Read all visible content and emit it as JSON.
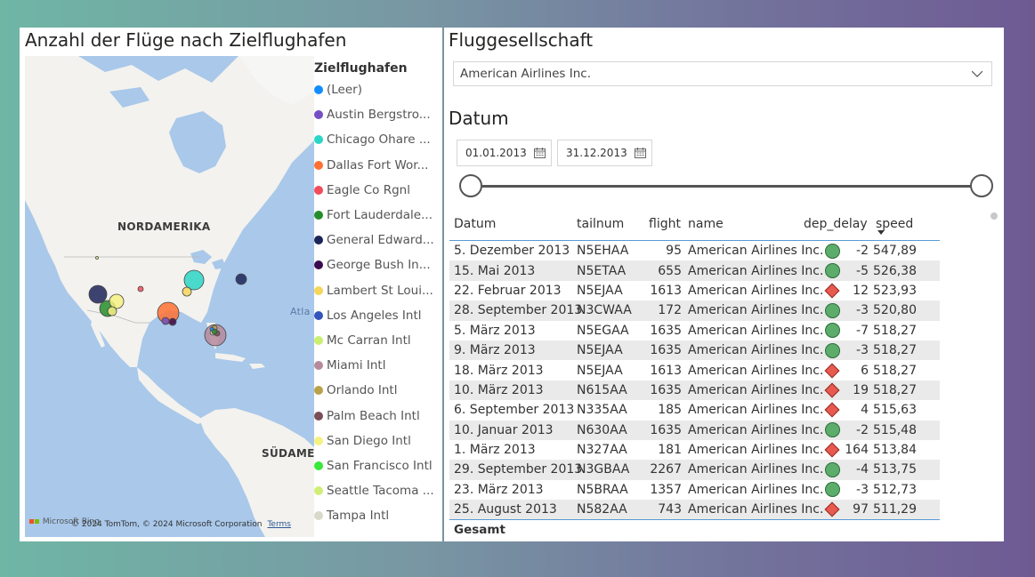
{
  "map_visual": {
    "title": "Anzahl der Flüge nach Zielflughafen",
    "continent_labels": [
      "NORDAMERIKA",
      "SÜDAMER",
      "Atla"
    ],
    "attribution": "© 2024 TomTom, © 2024 Microsoft Corporation",
    "terms_link": "Terms",
    "ms_logo_text": "Microsoft Bing"
  },
  "legend": {
    "title": "Zielflughafen",
    "items": [
      {
        "label": "(Leer)",
        "color": "#118dff"
      },
      {
        "label": "Austin Bergstro...",
        "color": "#744ec2"
      },
      {
        "label": "Chicago Ohare ...",
        "color": "#2ad6c6"
      },
      {
        "label": "Dallas Fort Wor...",
        "color": "#ff7133"
      },
      {
        "label": "Eagle Co Rgnl",
        "color": "#f04d58"
      },
      {
        "label": "Fort Lauderdale...",
        "color": "#268d2c"
      },
      {
        "label": "General Edward...",
        "color": "#1c2559"
      },
      {
        "label": "George Bush In...",
        "color": "#3a0c4f"
      },
      {
        "label": "Lambert St Loui...",
        "color": "#f5d55a"
      },
      {
        "label": "Los Angeles Intl",
        "color": "#3454bd"
      },
      {
        "label": "Mc Carran Intl",
        "color": "#c9ef70"
      },
      {
        "label": "Miami Intl",
        "color": "#b68a9c"
      },
      {
        "label": "Orlando Intl",
        "color": "#b9a24a"
      },
      {
        "label": "Palm Beach Intl",
        "color": "#7b4e55"
      },
      {
        "label": "San Diego Intl",
        "color": "#f6f282"
      },
      {
        "label": "San Francisco Intl",
        "color": "#39e839"
      },
      {
        "label": "Seattle Tacoma ...",
        "color": "#cfee77"
      },
      {
        "label": "Tampa Intl",
        "color": "#d9d9c9"
      }
    ]
  },
  "airline_slicer": {
    "title": "Fluggesellschaft",
    "selected": "American Airlines Inc."
  },
  "date_slicer": {
    "title": "Datum",
    "from": "01.01.2013",
    "to": "31.12.2013"
  },
  "table": {
    "columns": [
      "Datum",
      "tailnum",
      "flight",
      "name",
      "dep_delay",
      "speed"
    ],
    "sorted_column": "speed",
    "rows": [
      {
        "datum": "5. Dezember 2013",
        "tailnum": "N5EHAA",
        "flight": "95",
        "name": "American Airlines Inc.",
        "indicator": "circle",
        "dep_delay": "-2",
        "speed": "547,89"
      },
      {
        "datum": "15. Mai 2013",
        "tailnum": "N5ETAA",
        "flight": "655",
        "name": "American Airlines Inc.",
        "indicator": "circle",
        "dep_delay": "-5",
        "speed": "526,38"
      },
      {
        "datum": "22. Februar 2013",
        "tailnum": "N5EJAA",
        "flight": "1613",
        "name": "American Airlines Inc.",
        "indicator": "diamond",
        "dep_delay": "12",
        "speed": "523,93"
      },
      {
        "datum": "28. September 2013",
        "tailnum": "N3CWAA",
        "flight": "172",
        "name": "American Airlines Inc.",
        "indicator": "circle",
        "dep_delay": "-3",
        "speed": "520,80"
      },
      {
        "datum": "5. März 2013",
        "tailnum": "N5EGAA",
        "flight": "1635",
        "name": "American Airlines Inc.",
        "indicator": "circle",
        "dep_delay": "-7",
        "speed": "518,27"
      },
      {
        "datum": "9. März 2013",
        "tailnum": "N5EJAA",
        "flight": "1635",
        "name": "American Airlines Inc.",
        "indicator": "circle",
        "dep_delay": "-3",
        "speed": "518,27"
      },
      {
        "datum": "18. März 2013",
        "tailnum": "N5EJAA",
        "flight": "1613",
        "name": "American Airlines Inc.",
        "indicator": "diamond",
        "dep_delay": "6",
        "speed": "518,27"
      },
      {
        "datum": "10. März 2013",
        "tailnum": "N615AA",
        "flight": "1635",
        "name": "American Airlines Inc.",
        "indicator": "diamond",
        "dep_delay": "19",
        "speed": "518,27"
      },
      {
        "datum": "6. September 2013",
        "tailnum": "N335AA",
        "flight": "185",
        "name": "American Airlines Inc.",
        "indicator": "diamond",
        "dep_delay": "4",
        "speed": "515,63"
      },
      {
        "datum": "10. Januar 2013",
        "tailnum": "N630AA",
        "flight": "1635",
        "name": "American Airlines Inc.",
        "indicator": "circle",
        "dep_delay": "-2",
        "speed": "515,48"
      },
      {
        "datum": "1. März 2013",
        "tailnum": "N327AA",
        "flight": "181",
        "name": "American Airlines Inc.",
        "indicator": "diamond",
        "dep_delay": "164",
        "speed": "513,84"
      },
      {
        "datum": "29. September 2013",
        "tailnum": "N3GBAA",
        "flight": "2267",
        "name": "American Airlines Inc.",
        "indicator": "circle",
        "dep_delay": "-4",
        "speed": "513,75"
      },
      {
        "datum": "23. März 2013",
        "tailnum": "N5BRAA",
        "flight": "1357",
        "name": "American Airlines Inc.",
        "indicator": "circle",
        "dep_delay": "-3",
        "speed": "512,73"
      },
      {
        "datum": "25. August 2013",
        "tailnum": "N582AA",
        "flight": "743",
        "name": "American Airlines Inc.",
        "indicator": "diamond",
        "dep_delay": "97",
        "speed": "511,29"
      }
    ],
    "footer_label": "Gesamt"
  }
}
